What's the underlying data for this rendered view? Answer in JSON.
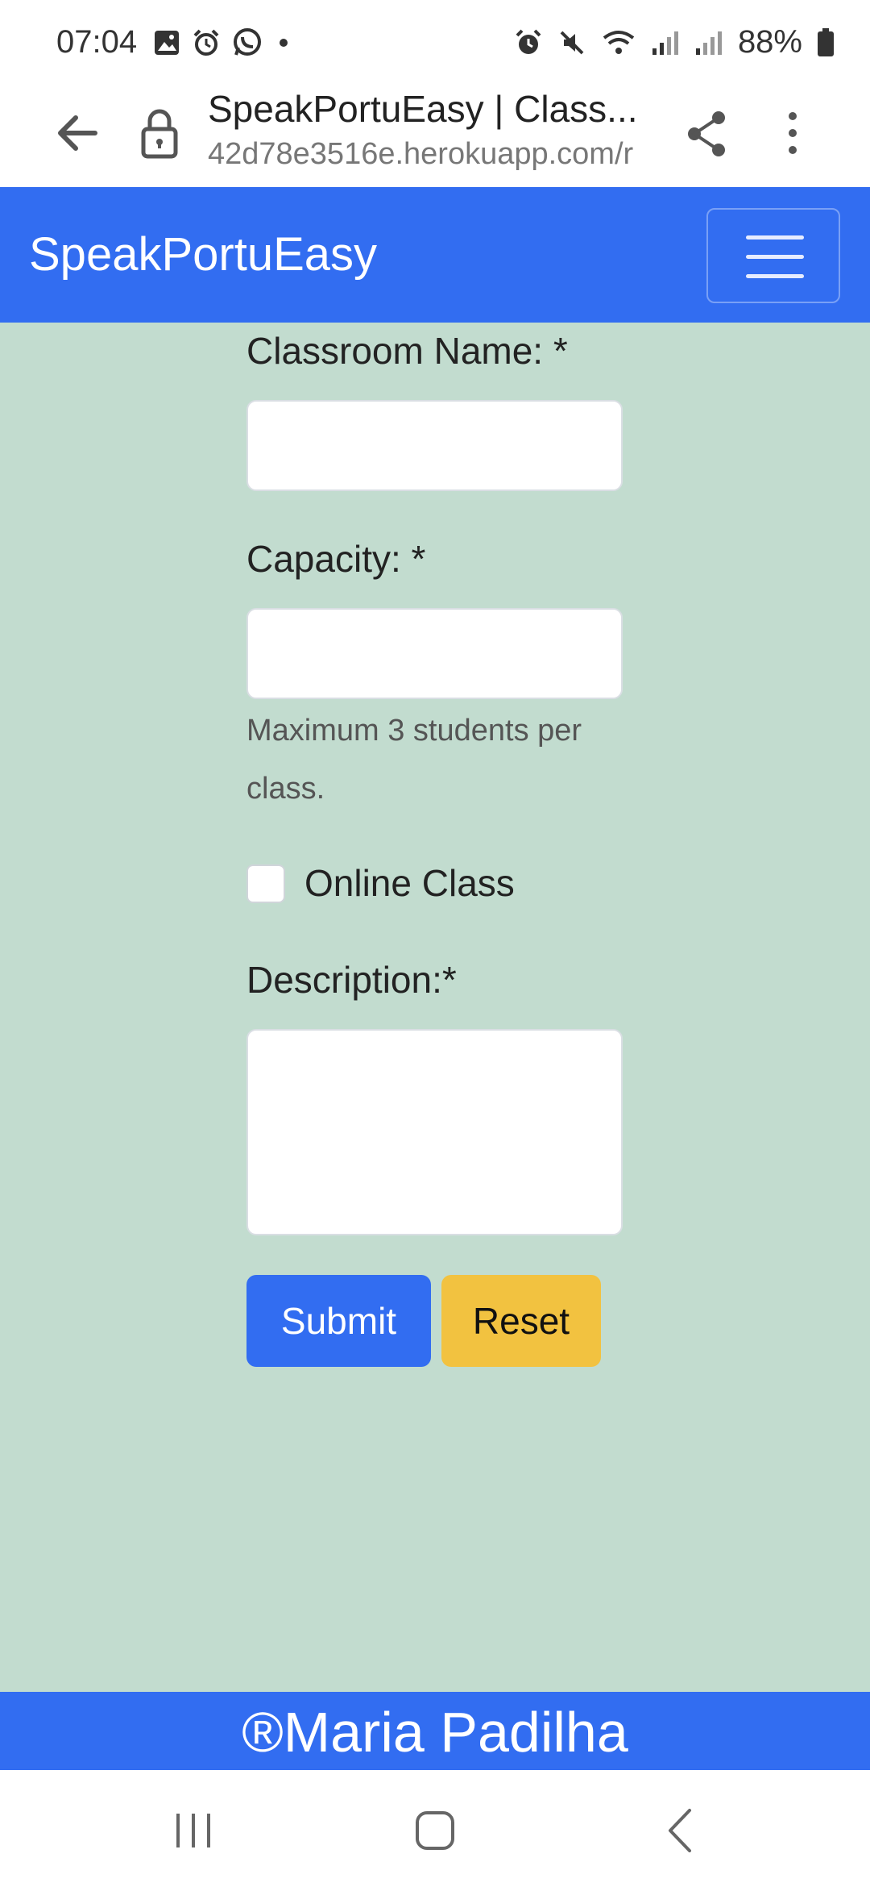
{
  "status_bar": {
    "time": "07:04",
    "battery_percent": "88%",
    "icons": [
      "gallery-icon",
      "alarm-icon",
      "whatsapp-icon",
      "dot-icon",
      "alarm-icon",
      "mute-icon",
      "wifi-icon",
      "signal-icon",
      "signal-icon",
      "battery-icon"
    ]
  },
  "browser": {
    "title": "SpeakPortuEasy | Class...",
    "url": "42d78e3516e.herokuapp.com/r"
  },
  "navbar": {
    "brand": "SpeakPortuEasy"
  },
  "form": {
    "classroom_name_label": "Classroom Name: *",
    "classroom_name_value": "",
    "capacity_label": "Capacity: *",
    "capacity_value": "",
    "capacity_help": "Maximum 3 students per class.",
    "online_class_label": "Online Class",
    "online_class_checked": false,
    "description_label": "Description:*",
    "description_value": "",
    "submit_label": "Submit",
    "reset_label": "Reset"
  },
  "footer": {
    "text": "®Maria Padilha"
  },
  "colors": {
    "primary": "#326df1",
    "background": "#c2dccf",
    "reset": "#f2c240"
  }
}
